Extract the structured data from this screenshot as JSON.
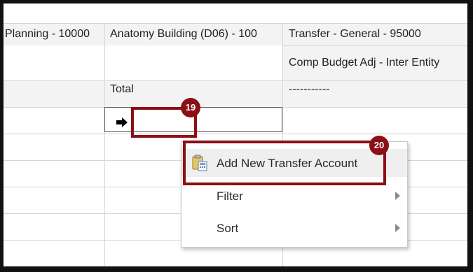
{
  "grid": {
    "header_row1": [
      "Planning - 10000",
      "Anatomy Building (D06) - 100",
      "Transfer - General - 95000"
    ],
    "header_row2": [
      "Comp Budget Adj - Inter Entity"
    ],
    "total_row": [
      "Total",
      "-----------"
    ]
  },
  "annotations": {
    "step_19": "19",
    "step_20": "20"
  },
  "context_menu": {
    "items": [
      {
        "label": "Add New Transfer Account",
        "icon": "clipboard-calculator-icon"
      },
      {
        "label": "Filter",
        "icon": "chevron-right-icon"
      },
      {
        "label": "Sort",
        "icon": "chevron-right-icon"
      }
    ]
  },
  "colors": {
    "annotation": "#8b0f14",
    "grid_line": "#d6d6d6",
    "row_shade": "#f3f3f3"
  }
}
